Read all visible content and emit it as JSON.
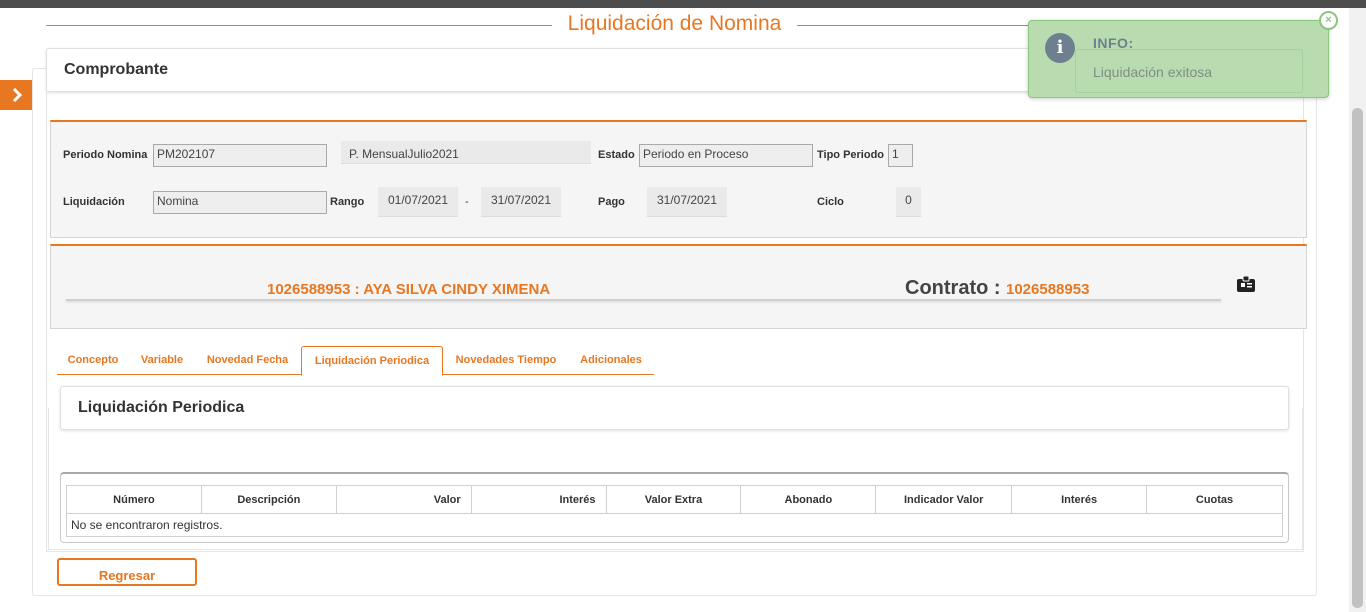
{
  "page": {
    "title": "Liquidación de Nomina"
  },
  "comprobante": {
    "title": "Comprobante"
  },
  "form": {
    "periodo_nomina_label": "Periodo Nomina",
    "periodo_nomina_value": "PM202107",
    "periodo_desc_value": "P. MensualJulio2021",
    "estado_label": "Estado",
    "estado_value": "Periodo en Proceso",
    "tipo_periodo_label": "Tipo Periodo",
    "tipo_periodo_value": "1",
    "liquidacion_label": "Liquidación",
    "liquidacion_value": "Nomina",
    "rango_label": "Rango",
    "rango_desde": "01/07/2021",
    "rango_sep": "-",
    "rango_hasta": "31/07/2021",
    "pago_label": "Pago",
    "pago_value": "31/07/2021",
    "ciclo_label": "Ciclo",
    "ciclo_value": "0"
  },
  "employee": {
    "name": "1026588953 : AYA SILVA CINDY XIMENA",
    "contrato_label": "Contrato :",
    "contrato_value": "1026588953",
    "icon": "id-card-icon"
  },
  "tabs": [
    {
      "label": "Concepto",
      "active": false
    },
    {
      "label": "Variable",
      "active": false
    },
    {
      "label": "Novedad Fecha",
      "active": false
    },
    {
      "label": "Liquidación Periodica",
      "active": true
    },
    {
      "label": "Novedades Tiempo",
      "active": false
    },
    {
      "label": "Adicionales",
      "active": false
    }
  ],
  "section": {
    "title": "Liquidación Periodica"
  },
  "table": {
    "columns": [
      "Número",
      "Descripción",
      "Valor",
      "Interés",
      "Valor Extra",
      "Abonado",
      "Indicador Valor",
      "Interés",
      "Cuotas"
    ],
    "empty_message": "No se encontraron registros."
  },
  "buttons": {
    "back_label": "Regresar"
  },
  "toast": {
    "title": "INFO:",
    "message": "Liquidación exitosa",
    "close_icon": "close-icon",
    "info_icon": "info-icon",
    "info_glyph": "i",
    "close_glyph": "×"
  },
  "colors": {
    "accent": "#e87722",
    "toast_bg": "#b9dbb0",
    "toast_border": "#8cc57d"
  }
}
